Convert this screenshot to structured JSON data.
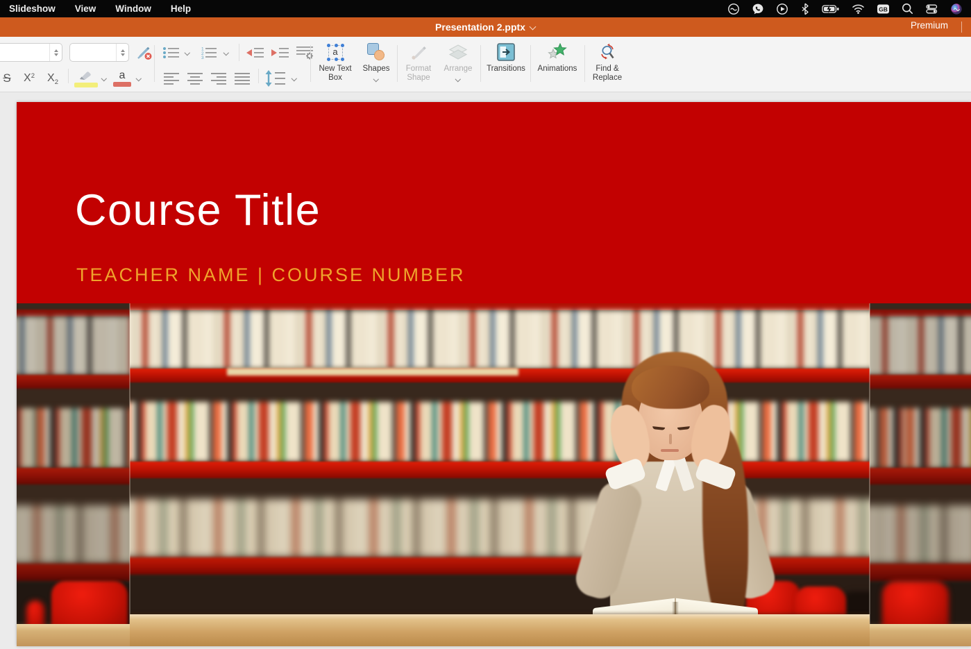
{
  "menu_bar": {
    "items": [
      {
        "label": "Slideshow"
      },
      {
        "label": "View"
      },
      {
        "label": "Window"
      },
      {
        "label": "Help"
      }
    ],
    "keyboard_layout": "GB",
    "status_icons": [
      "creative-cloud",
      "viber",
      "media-play",
      "bluetooth",
      "battery-charging",
      "wifi",
      "input-source",
      "spotlight-search",
      "control-center",
      "siri"
    ]
  },
  "title_bar": {
    "document_title": "Presentation 2.pptx",
    "premium_label": "Premium"
  },
  "toolbar": {
    "font_name_value": "",
    "font_size_value": "",
    "strikethrough_label": "S",
    "superscript_base": "X",
    "superscript_mark": "2",
    "subscript_base": "X",
    "subscript_mark": "2",
    "font_color_letter": "a",
    "big_buttons": [
      {
        "label": "New Text Box"
      },
      {
        "label": "Shapes"
      },
      {
        "label": "Format Shape"
      },
      {
        "label": "Arrange"
      },
      {
        "label": "Transitions"
      },
      {
        "label": "Animations"
      },
      {
        "label": "Find & Replace"
      }
    ]
  },
  "slide": {
    "title": "Course Title",
    "subtitle": "TEACHER NAME | COURSE NUMBER"
  },
  "colors": {
    "titlebar_orange": "#ce5a1e",
    "banner_red": "#c20101",
    "subtitle_gold": "#efa42c",
    "accent_teal": "#69a9c6",
    "accent_salmon": "#dd7065"
  }
}
